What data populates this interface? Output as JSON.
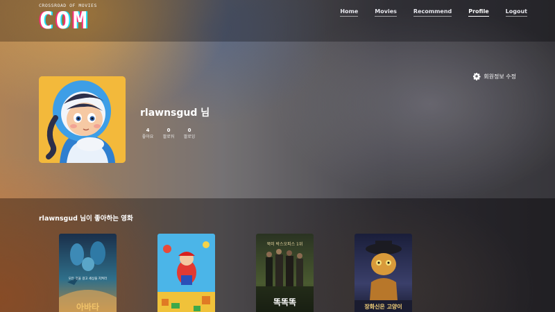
{
  "header": {
    "logo_tagline": "CROSSROAD OF MOVIES",
    "logo_word": "COM",
    "nav": [
      {
        "label": "Home"
      },
      {
        "label": "Movies"
      },
      {
        "label": "Recommend"
      },
      {
        "label": "Profile",
        "active": true
      },
      {
        "label": "Logout"
      }
    ]
  },
  "profile": {
    "username": "rlawnsgud 님",
    "edit_label": "회원정보 수정",
    "stats": [
      {
        "value": "4",
        "label": "좋아요"
      },
      {
        "value": "0",
        "label": "팔로워"
      },
      {
        "value": "0",
        "label": "팔로잉"
      }
    ]
  },
  "liked": {
    "title": "rlawnsgud 님이 좋아하는 영화",
    "posters": [
      {
        "title": "아바타",
        "tagline": "모든 것을 걸고 세상을 지켜라"
      },
      {
        "title": "",
        "tagline": ""
      },
      {
        "title": "똑똑똑",
        "tagline": "",
        "top_text": "북미 박스오피스 1위"
      },
      {
        "title": "장화신은 고양이",
        "tagline": ""
      }
    ]
  },
  "colors": {
    "accent_pink": "#ff2a7a",
    "accent_cyan": "#1ee3ff",
    "avatar_bg": "#f3b93b"
  }
}
